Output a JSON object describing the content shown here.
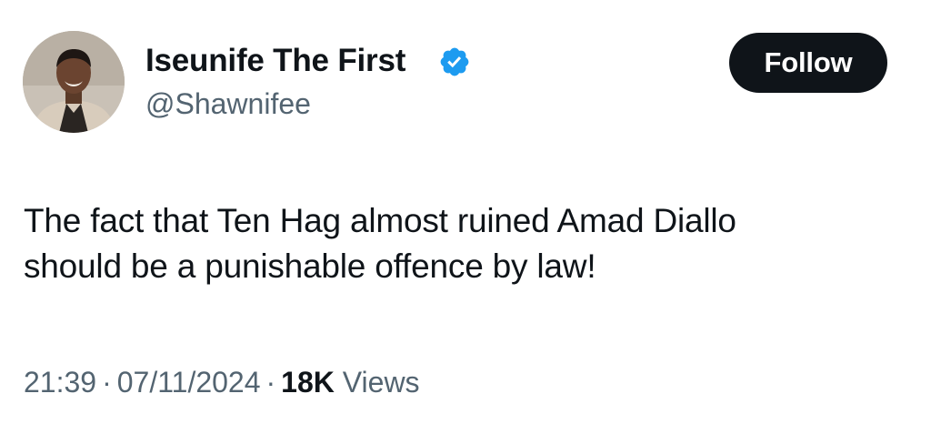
{
  "tweet": {
    "author": {
      "display_name": "Iseunife The First",
      "handle": "@Shawnifee",
      "verified": true,
      "verified_color": "#1d9bf0",
      "avatar": "profile-photo"
    },
    "follow_button": {
      "label": "Follow",
      "background": "#0f1419",
      "text_color": "#ffffff"
    },
    "text_lines": [
      "The fact that Ten Hag almost ruined Amad Diallo",
      "should be a punishable offence by law!"
    ],
    "meta": {
      "time": "21:39",
      "separator": "·",
      "date": "07/11/2024",
      "views_count": "18K",
      "views_label": "Views"
    }
  }
}
